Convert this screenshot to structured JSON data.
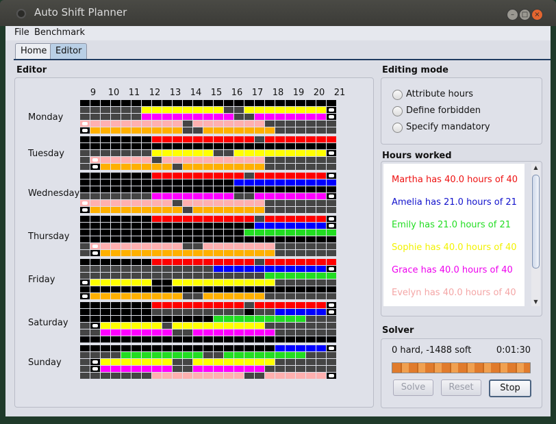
{
  "window": {
    "title": "Auto Shift Planner"
  },
  "menu": {
    "file": "File",
    "benchmark": "Benchmark"
  },
  "tabs": [
    {
      "label": "Home"
    },
    {
      "label": "Editor"
    }
  ],
  "editor": {
    "title": "Editor",
    "hours": [
      "9",
      "10",
      "11",
      "12",
      "13",
      "14",
      "15",
      "16",
      "17",
      "18",
      "19",
      "20",
      "21"
    ],
    "days": [
      "Monday",
      "Tuesday",
      "Wednesday",
      "Thursday",
      "Friday",
      "Saturday",
      "Sunday"
    ],
    "legend_colors": {
      "red": "#ff0000",
      "blue": "#0000ff",
      "green": "#22dd22",
      "yellow": "#ffff00",
      "magenta": "#ff00ff",
      "pink": "#ffb0b0",
      "orange": "#ffb000"
    },
    "schedule": [
      {
        "day": "Monday",
        "rows": [
          {
            "mandatory": false,
            "cells": "BBBBBBBBBBBBBBBBBBBBBBBBB"
          },
          {
            "mandatory": true,
            "cells": "DDDDDDYYYYYYYYDDYYYYYYYYW"
          },
          {
            "mandatory": false,
            "cells": "DDDDDDMMMMMMMMMDDMMMMMMMW"
          },
          {
            "mandatory": true,
            "cells": "KPPPPPPPPPDPPPPPPPDDDDDDD"
          },
          {
            "mandatory": true,
            "cells": "WOOOOOOOOODDOOOOOOODDDDDD"
          }
        ]
      },
      {
        "day": "Tuesday",
        "rows": [
          {
            "mandatory": false,
            "cells": "BBBBBBBRRRRRRRRRRDRRRRRRR"
          },
          {
            "mandatory": false,
            "cells": "BBBBBBBBBBBBBBBBBBBBBBBBB"
          },
          {
            "mandatory": true,
            "cells": "DDDDDDDYYYYYYDDYYYYYYYYYW"
          },
          {
            "mandatory": true,
            "cells": "DKPPPPPDPPPPPPPPPPDDDDDDD"
          },
          {
            "mandatory": true,
            "cells": "DWOOOOOOODOOOOOOOODDDDDDD"
          }
        ]
      },
      {
        "day": "Wednesday",
        "rows": [
          {
            "mandatory": false,
            "cells": "BBBBBBBRRRRRRRRRDRRRRRRRW"
          },
          {
            "mandatory": false,
            "cells": "BBBBBBBBBBBBBBBLLLLLLLLLL"
          },
          {
            "mandatory": false,
            "cells": "BBBBBBBBBBBBBBBBBBBBBBBBB"
          },
          {
            "mandatory": true,
            "cells": "DDDDDDDMMMMMMMMDDMMMMMMMW"
          },
          {
            "mandatory": true,
            "cells": "KPPPPPPPPDPPPPPPPPDDDDDDD"
          },
          {
            "mandatory": true,
            "cells": "WOOOOOOOOODOOOOOOODDDDDDD"
          }
        ]
      },
      {
        "day": "Thursday",
        "rows": [
          {
            "mandatory": false,
            "cells": "BBBBBBBRRRRRRRRRRDRRRRRRW"
          },
          {
            "mandatory": false,
            "cells": "BBBBBBBBBBBBBBBBBLLLLLLLW"
          },
          {
            "mandatory": false,
            "cells": "BBBBBBBBBBBBBBBBGGGGGGGGG"
          },
          {
            "mandatory": false,
            "cells": "BBBBBBBBBBBBBBBBBBBBBBBBB"
          },
          {
            "mandatory": true,
            "cells": "DKPPPPPPPPDDPPPPPPPDDDDDD"
          },
          {
            "mandatory": true,
            "cells": "DWOOOOOOOOOOOOOOOOODDDDDD"
          }
        ]
      },
      {
        "day": "Friday",
        "rows": [
          {
            "mandatory": false,
            "cells": "BBBBBBBRRRRRRRRRRDRRRRRRR"
          },
          {
            "mandatory": false,
            "cells": "DDDDDDDDDDDDDLLLLLLLLLLLW"
          },
          {
            "mandatory": false,
            "cells": "DDDDDDDDDDDDDDDDDDGGGGGGG"
          },
          {
            "mandatory": true,
            "cells": "WYYYYYYBBYYYYYYYYYYDDDDDD"
          },
          {
            "mandatory": false,
            "cells": "BBBBBBBBBBBBBBBBBBBBBBBBB"
          },
          {
            "mandatory": true,
            "cells": "WOOOOOOOOODDOOOOOODDDDDDD"
          }
        ]
      },
      {
        "day": "Saturday",
        "rows": [
          {
            "mandatory": false,
            "cells": "BBBBBBBRRRRRRRRRDRRRRRRRW"
          },
          {
            "mandatory": false,
            "cells": "BBBBBBBDDDDDDDDDBDDLLLLLW"
          },
          {
            "mandatory": false,
            "cells": "BBBBBBBBBBBBBGGGGGGGGGDDD"
          },
          {
            "mandatory": true,
            "cells": "DWYYYYYYDYYYYYYYYYDDDDDDD"
          },
          {
            "mandatory": false,
            "cells": "DDMMMMMMMDDMMMMMMMMDDDDDD"
          },
          {
            "mandatory": false,
            "cells": "BBBBBBBBBBBBBBBBBBBBBBBBB"
          }
        ]
      },
      {
        "day": "Sunday",
        "rows": [
          {
            "mandatory": false,
            "cells": "BBBBBBBBBBBBBBBBBBBLLLLLW"
          },
          {
            "mandatory": false,
            "cells": "DDDDGGGGGGGGDDGGGGGGGGDDD"
          },
          {
            "mandatory": true,
            "cells": "DWYYYYYYYDDYYYYYYYYDDDDDD"
          },
          {
            "mandatory": true,
            "cells": "DWMMMMMMMDDMMMMMMMDDDDDDD"
          },
          {
            "mandatory": true,
            "cells": "DDDDDDDPPPPPPPPPDDPPPPPPW"
          }
        ]
      }
    ]
  },
  "editing_mode": {
    "title": "Editing mode",
    "options": [
      "Attribute hours",
      "Define forbidden",
      "Specify mandatory"
    ]
  },
  "hours_worked": {
    "title": "Hours worked",
    "lines": [
      {
        "text": "Martha has 40.0 hours of 40",
        "color": "#ee1111"
      },
      {
        "text": "Amelia has 21.0 hours of 21",
        "color": "#1111cc"
      },
      {
        "text": "Emily has 21.0 hours of 21",
        "color": "#22dd22"
      },
      {
        "text": "Sophie has 40.0 hours of 40",
        "color": "#f2f200"
      },
      {
        "text": "Grace has 40.0 hours of 40",
        "color": "#ee00ee"
      },
      {
        "text": "Evelyn has 40.0 hours of 40",
        "color": "#f4a6a6"
      }
    ]
  },
  "solver": {
    "title": "Solver",
    "score": "0 hard, -1488 soft",
    "time": "0:01:30",
    "solve_label": "Solve",
    "reset_label": "Reset",
    "stop_label": "Stop"
  }
}
